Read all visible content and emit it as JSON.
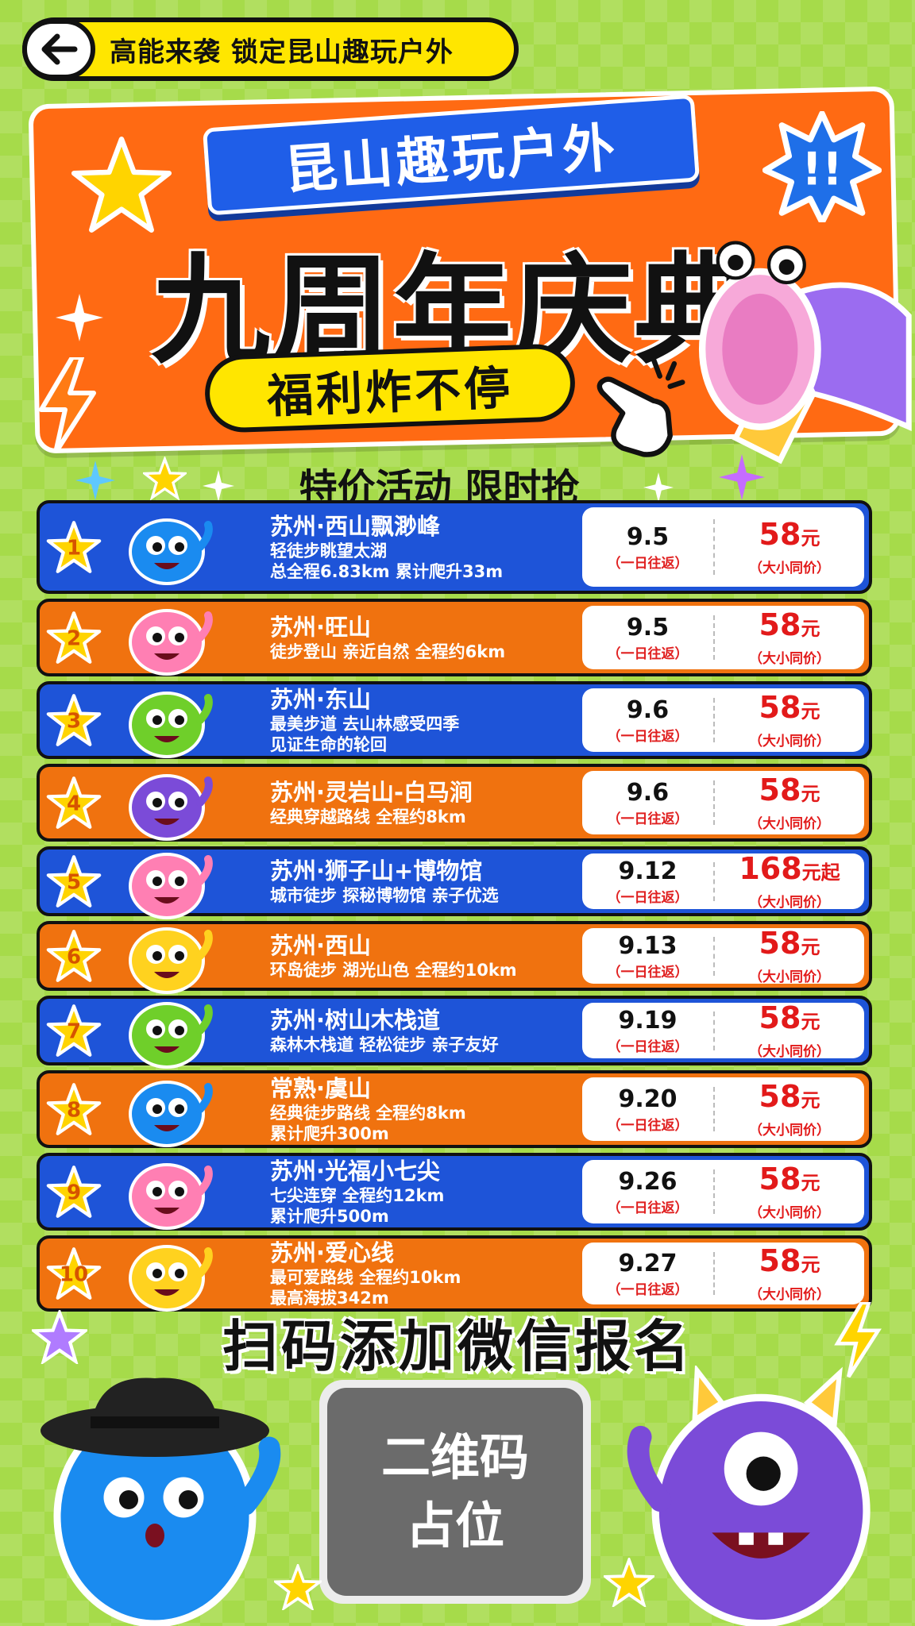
{
  "topbar": {
    "title": "高能来袭 锁定昆山趣玩户外"
  },
  "hero": {
    "ribbon": "昆山趣玩户外",
    "title": "九周年庆典",
    "benefit": "福利炸不停"
  },
  "subtitle": "特价活动 限时抢",
  "events": [
    {
      "rank": "1",
      "color": "blue",
      "title": "苏州·西山飘渺峰",
      "desc": [
        "轻徒步眺望太湖",
        "总全程6.83km 累计爬升33m"
      ],
      "date": "9.5",
      "date_note": "（一日往返）",
      "price": "58",
      "price_unit": "元",
      "price_note": "（大小同价）",
      "monster_color": "#1a8bf0"
    },
    {
      "rank": "2",
      "color": "orange",
      "title": "苏州·旺山",
      "desc": [
        "徒步登山 亲近自然 全程约6km"
      ],
      "date": "9.5",
      "date_note": "（一日往返）",
      "price": "58",
      "price_unit": "元",
      "price_note": "（大小同价）",
      "monster_color": "#ff7fb3"
    },
    {
      "rank": "3",
      "color": "blue",
      "title": "苏州·东山",
      "desc": [
        "最美步道 去山林感受四季",
        "见证生命的轮回"
      ],
      "date": "9.6",
      "date_note": "（一日往返）",
      "price": "58",
      "price_unit": "元",
      "price_note": "（大小同价）",
      "monster_color": "#6fcf2a"
    },
    {
      "rank": "4",
      "color": "orange",
      "title": "苏州·灵岩山-白马涧",
      "desc": [
        "经典穿越路线 全程约8km"
      ],
      "date": "9.6",
      "date_note": "（一日往返）",
      "price": "58",
      "price_unit": "元",
      "price_note": "（大小同价）",
      "monster_color": "#7b4bd8"
    },
    {
      "rank": "5",
      "color": "blue",
      "title": "苏州·狮子山+博物馆",
      "desc": [
        "城市徒步 探秘博物馆 亲子优选"
      ],
      "date": "9.12",
      "date_note": "（一日往返）",
      "price": "168",
      "price_unit": "元起",
      "price_note": "（大小同价）",
      "monster_color": "#ff7fb3"
    },
    {
      "rank": "6",
      "color": "orange",
      "title": "苏州·西山",
      "desc": [
        "环岛徒步 湖光山色 全程约10km"
      ],
      "date": "9.13",
      "date_note": "（一日往返）",
      "price": "58",
      "price_unit": "元",
      "price_note": "（大小同价）",
      "monster_color": "#ffd21f"
    },
    {
      "rank": "7",
      "color": "blue",
      "title": "苏州·树山木栈道",
      "desc": [
        "森林木栈道 轻松徒步 亲子友好"
      ],
      "date": "9.19",
      "date_note": "（一日往返）",
      "price": "58",
      "price_unit": "元",
      "price_note": "（大小同价）",
      "monster_color": "#6fcf2a"
    },
    {
      "rank": "8",
      "color": "orange",
      "title": "常熟·虞山",
      "desc": [
        "经典徒步路线 全程约8km",
        "累计爬升300m"
      ],
      "date": "9.20",
      "date_note": "（一日往返）",
      "price": "58",
      "price_unit": "元",
      "price_note": "（大小同价）",
      "monster_color": "#1a8bf0"
    },
    {
      "rank": "9",
      "color": "blue",
      "title": "苏州·光福小七尖",
      "desc": [
        "七尖连穿 全程约12km",
        "累计爬升500m"
      ],
      "date": "9.26",
      "date_note": "（一日往返）",
      "price": "58",
      "price_unit": "元",
      "price_note": "（大小同价）",
      "monster_color": "#ff7fb3"
    },
    {
      "rank": "10",
      "color": "orange",
      "title": "苏州·爱心线",
      "desc": [
        "最可爱路线 全程约10km",
        "最高海拔342m"
      ],
      "date": "9.27",
      "date_note": "（一日往返）",
      "price": "58",
      "price_unit": "元",
      "price_note": "（大小同价）",
      "monster_color": "#ffd21f"
    }
  ],
  "cta": "扫码添加微信报名",
  "qr": {
    "line1": "二维码",
    "line2": "占位"
  },
  "colors": {
    "blue_row": "#1e54d8",
    "orange_row": "#f0720f",
    "price_red": "#e21a1a",
    "accent_yellow": "#ffe600"
  },
  "icons": [
    "back-arrow-icon",
    "star-icon",
    "sparkle-icon",
    "megaphone-icon",
    "pointing-hand-icon",
    "lightning-icon",
    "monster-mascot-icon"
  ]
}
